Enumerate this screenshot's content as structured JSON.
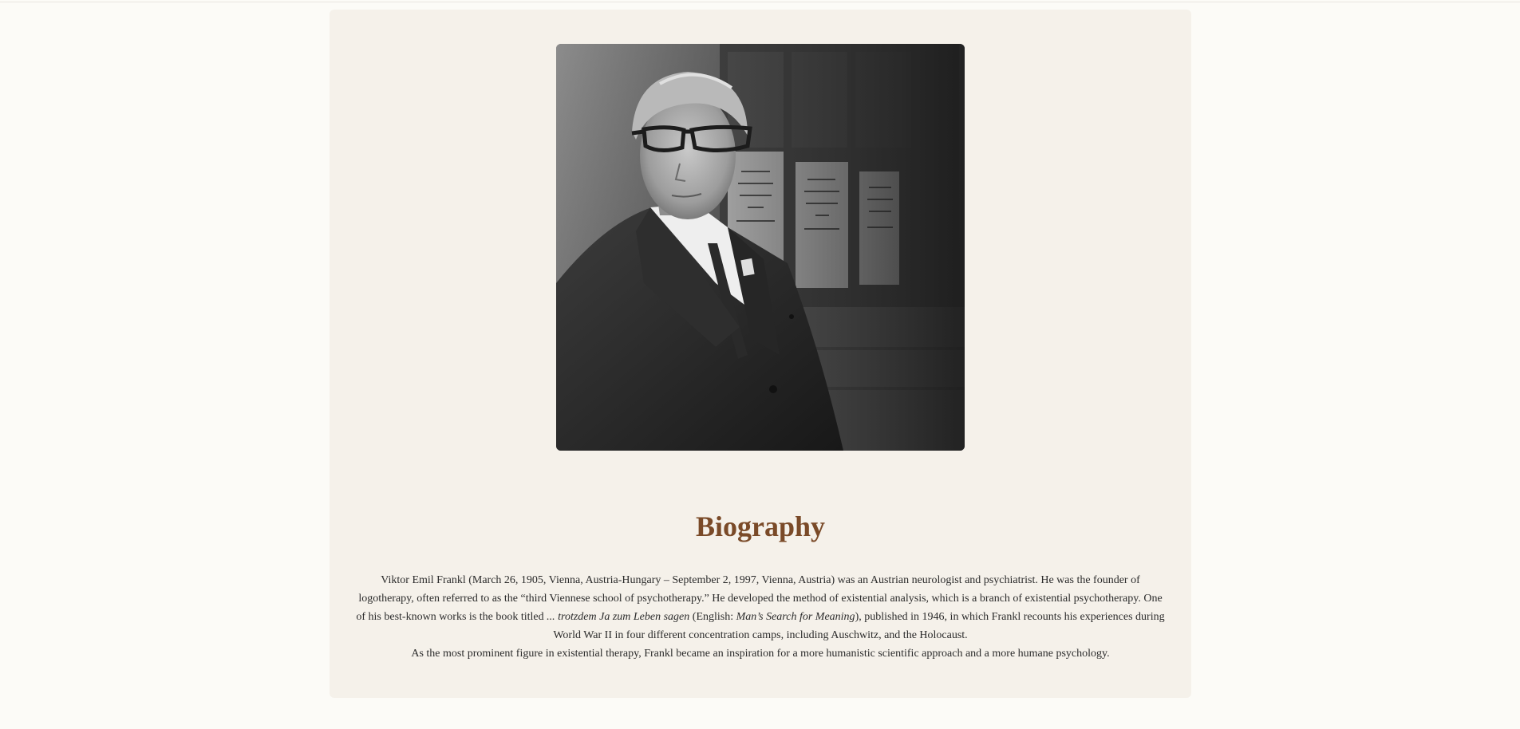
{
  "photo": {
    "alt": "Black and white portrait of Viktor Frankl wearing glasses and a dark suit"
  },
  "biography": {
    "heading": "Biography",
    "paragraph_1": {
      "part_1": "Viktor Emil Frankl (March 26, 1905, Vienna, Austria-Hungary – September 2, 1997, Vienna, Austria) was an Austrian neurologist and psychiatrist. He was the founder of logotherapy, often referred to as the “third Viennese school of psychotherapy.” He developed the method of existential analysis, which is a branch of existential psychotherapy. One of his best-known works is the book titled ",
      "book_title_german": "... trotzdem Ja zum Leben sagen",
      "part_2": " (English: ",
      "book_title_english": "Man’s Search for Meaning",
      "part_3": "), published in 1946, in which Frankl recounts his experiences during World War II in four different concentration camps, including Auschwitz, and the Holocaust."
    },
    "paragraph_2": "As the most prominent figure in existential therapy, Frankl became an inspiration for a more humanistic scientific approach and a more humane psychology."
  }
}
